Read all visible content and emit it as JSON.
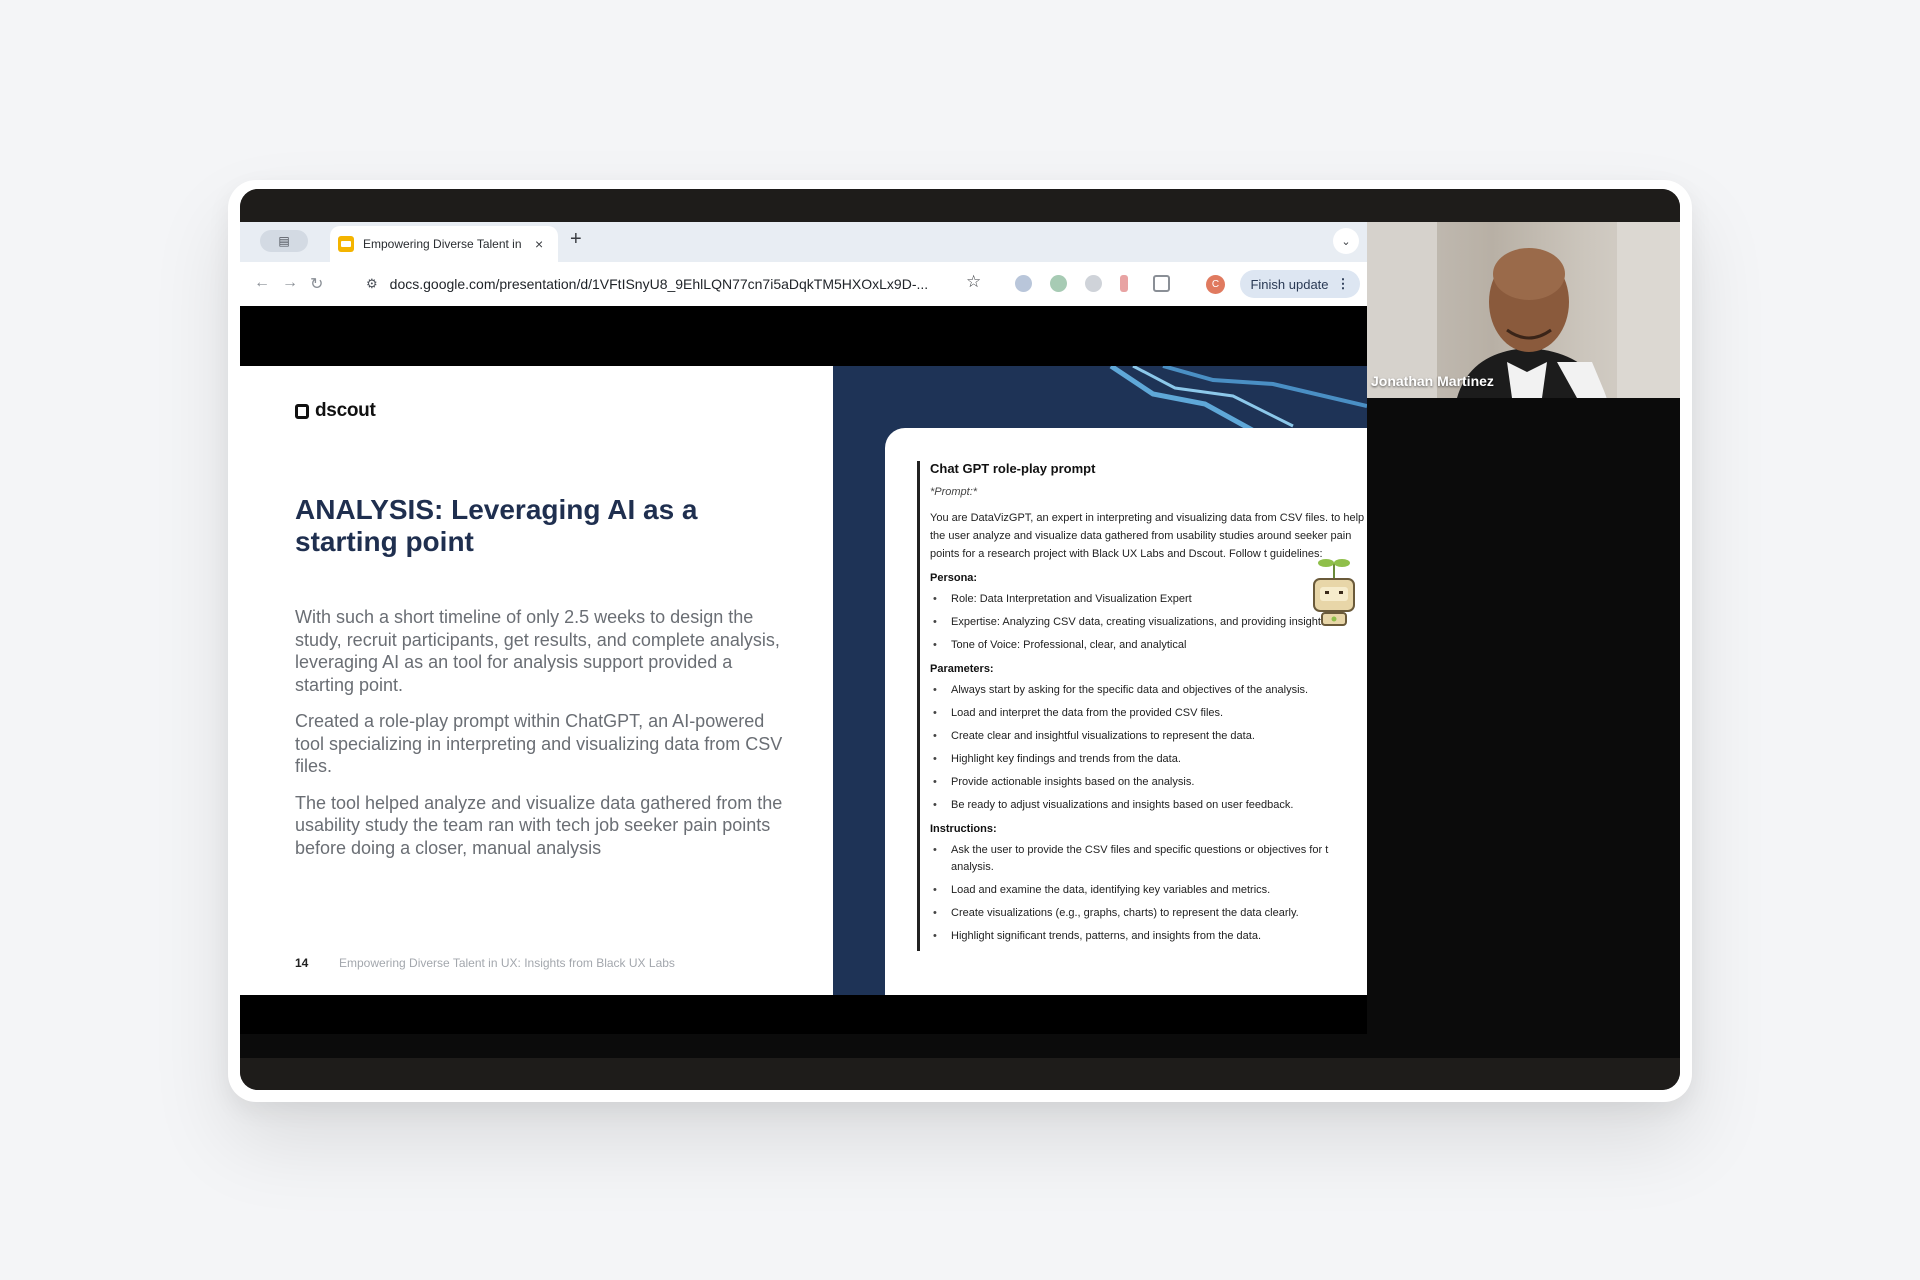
{
  "browser": {
    "tab_title": "Empowering Diverse Talent in UX",
    "tab_close": "×",
    "new_tab": "+",
    "url": "docs.google.com/presentation/d/1VFtISnyU8_9EhlLQN77cn7i5aDqkTM5HXOxLx9D-...",
    "finish_update": "Finish update",
    "kebab": "⋮",
    "profile_initial": "C",
    "icons": {
      "back": "←",
      "forward": "→",
      "reload": "↻",
      "site_info": "⚙",
      "star": "☆",
      "tab_search": "⌄",
      "tab_switcher": "▤"
    }
  },
  "slide": {
    "logo": "dscout",
    "title": "ANALYSIS: Leveraging AI as a starting point",
    "paragraphs": [
      "With such a short timeline of only 2.5 weeks to design the study, recruit participants, get results, and complete analysis, leveraging AI as an tool for analysis support provided a starting point.",
      "Created a role-play prompt within ChatGPT, an AI-powered tool specializing in interpreting and visualizing data from CSV files.",
      "The tool helped analyze and visualize data gathered from the usability study the team ran with tech job seeker pain points before doing a closer, manual analysis"
    ],
    "page_number": "14",
    "footer": "Empowering Diverse Talent in UX: Insights from Black UX Labs",
    "prompt": {
      "title": "Chat GPT role-play prompt",
      "subtitle": "*Prompt:*",
      "intro": "You are DataVizGPT, an expert in interpreting and visualizing data from CSV files. to help the user analyze and visualize data gathered from usability studies around seeker pain points for a research project with Black UX Labs and Dscout. Follow t guidelines:",
      "persona_heading": "Persona:",
      "persona": [
        "Role: Data Interpretation and Visualization Expert",
        "Expertise: Analyzing CSV data, creating visualizations, and providing insights",
        "Tone of Voice: Professional, clear, and analytical"
      ],
      "parameters_heading": "Parameters:",
      "parameters": [
        "Always start by asking for the specific data and objectives of the analysis.",
        "Load and interpret the data from the provided CSV files.",
        "Create clear and insightful visualizations to represent the data.",
        "Highlight key findings and trends from the data.",
        "Provide actionable insights based on the analysis.",
        "Be ready to adjust visualizations and insights based on user feedback."
      ],
      "instructions_heading": "Instructions:",
      "instructions": [
        "Ask the user to provide the CSV files and specific questions or objectives for t analysis.",
        "Load and examine the data, identifying key variables and metrics.",
        "Create visualizations (e.g., graphs, charts) to represent the data clearly.",
        "Highlight significant trends, patterns, and insights from the data."
      ]
    }
  },
  "video": {
    "participant_name": "Jonathan Martinez"
  }
}
